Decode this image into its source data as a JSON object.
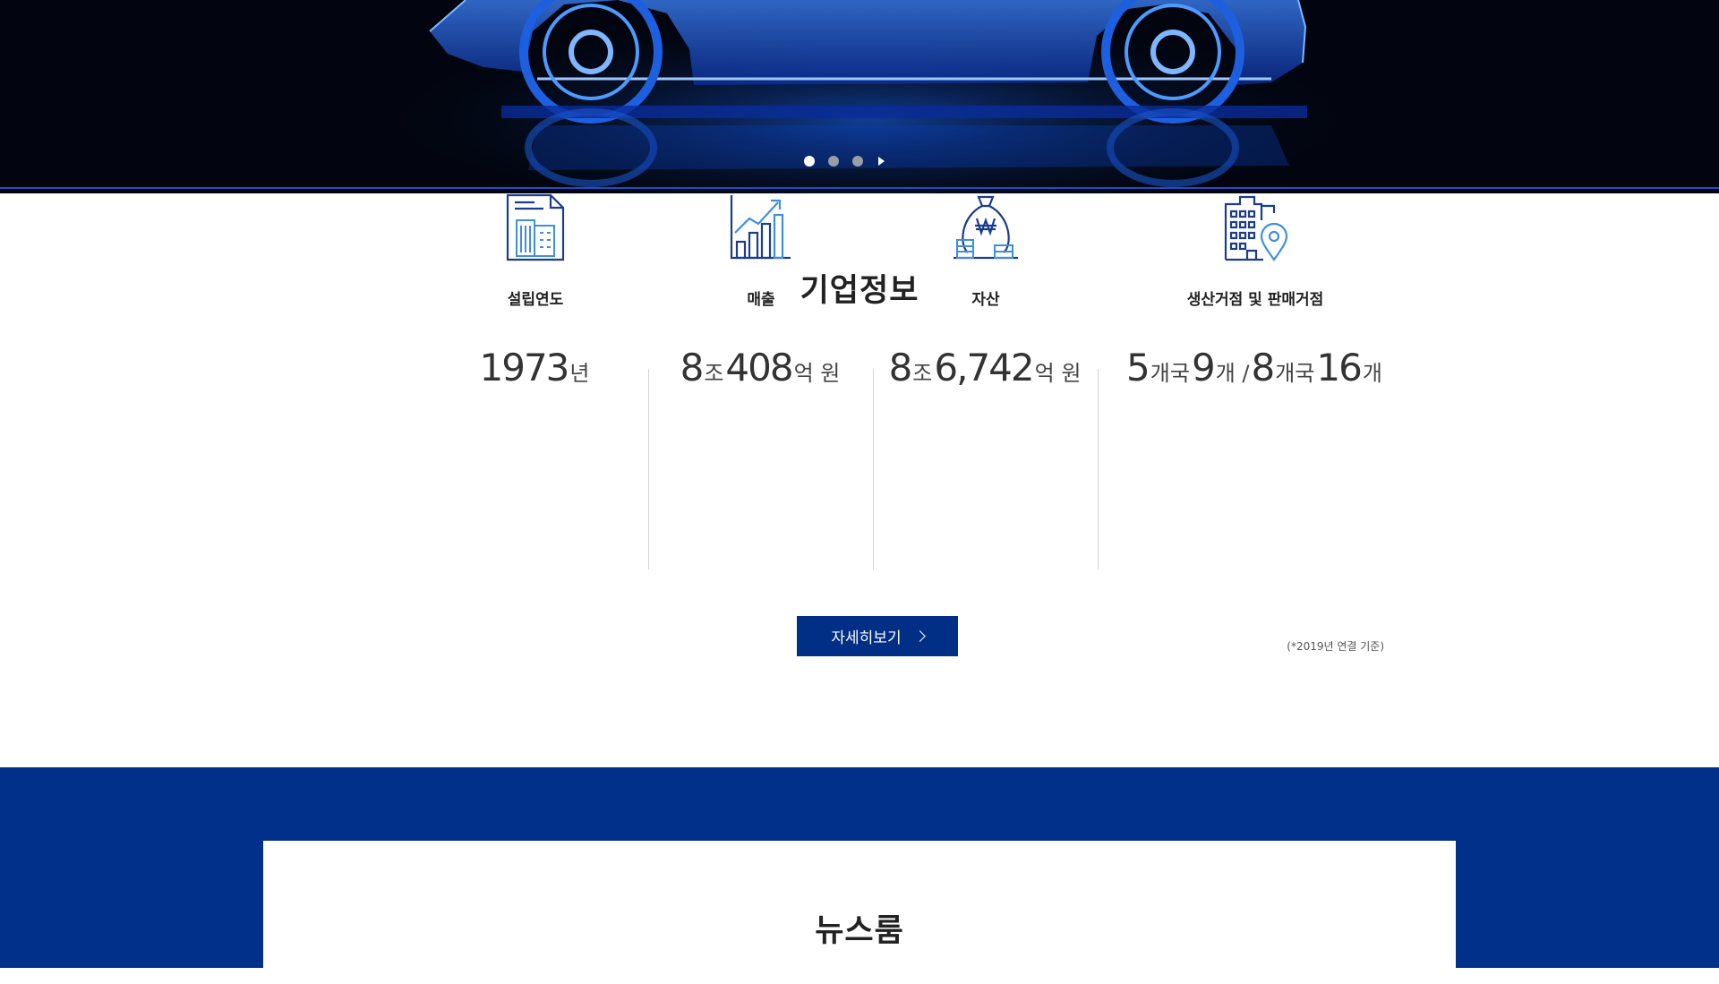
{
  "hero": {
    "slides": [
      "slide-1",
      "slide-2",
      "slide-3"
    ],
    "active_slide": 1,
    "control": "play-icon"
  },
  "company_info": {
    "title": "기업정보",
    "stats": [
      {
        "icon": "document-building-icon",
        "label": "설립연도",
        "parts": [
          {
            "n": "1973"
          },
          {
            "u": "년"
          }
        ]
      },
      {
        "icon": "growth-chart-icon",
        "label": "매출",
        "parts": [
          {
            "n": "8"
          },
          {
            "u": "조"
          },
          {
            "n": "408"
          },
          {
            "u": "억 원"
          }
        ]
      },
      {
        "icon": "money-bag-icon",
        "label": "자산",
        "parts": [
          {
            "n": "8"
          },
          {
            "u": "조"
          },
          {
            "n": "6,742"
          },
          {
            "u": "억 원"
          }
        ]
      },
      {
        "icon": "building-location-icon",
        "label": "생산거점 및 판매거점",
        "parts": [
          {
            "n": "5"
          },
          {
            "u": "개국"
          },
          {
            "n": "9"
          },
          {
            "u": "개 /"
          },
          {
            "n": "8"
          },
          {
            "u": "개국"
          },
          {
            "n": "16"
          },
          {
            "u": "개"
          }
        ]
      }
    ],
    "more_button": "자세히보기",
    "basis_note": "(*2019년 연결 기준)"
  },
  "newsroom": {
    "title": "뉴스룸"
  },
  "colors": {
    "brand_blue": "#00308a",
    "accent_light_blue": "#5aa0e6"
  }
}
